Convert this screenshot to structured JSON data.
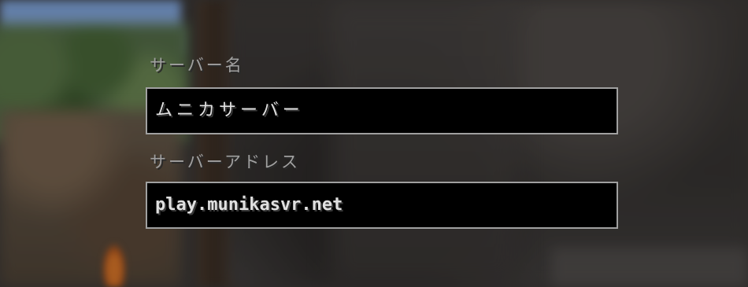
{
  "server_name": {
    "label": "サーバー名",
    "value": "ムニカサーバー"
  },
  "server_address": {
    "label": "サーバーアドレス",
    "value": "play.munikasvr.net"
  }
}
